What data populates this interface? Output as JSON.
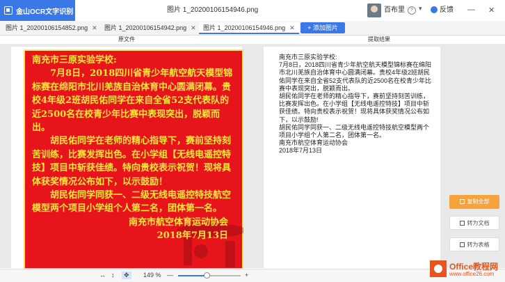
{
  "app": {
    "name": "金山OCR文字识别",
    "window_title": "图片 1_20200106154946.png"
  },
  "user": {
    "name": "百布里"
  },
  "header": {
    "feedback": "反馈",
    "minimize": "—",
    "close": "✕",
    "help": "?",
    "dropdown": "▾"
  },
  "tabs": [
    {
      "label": "图片 1_20200106154852.png",
      "active": false
    },
    {
      "label": "图片 1_20200106154942.png",
      "active": false
    },
    {
      "label": "图片 1_20200106154946.png",
      "active": true
    }
  ],
  "add_image": "+ 添加图片",
  "sections": {
    "left": "原文件",
    "right": "提取结果"
  },
  "poster": {
    "lines": [
      "南充市三原实验学校:",
      "7月8日，2018四川省青少年航空航天模型锦标赛在绵阳市北川羌族自治体育中心圆满闭幕。贵校4年级2班胡民佑同学在来自全省52支代表队的近2500名在校青少年比赛中表现突出，脱颖而出。",
      "胡民佑同学在老师的精心指导下，赛前坚持刻苦训练，比赛发挥出色。在小学组【无线电遥控特技】项目中斩获佳绩。特向贵校表示祝贺！现将具体获奖情况公布如下，以示鼓励！",
      "胡民佑同学同获一、二级无线电遥控特技航空模型两个项目小学组个人第二名，团体第一名。",
      "南充市航空体育运动协会",
      "2018年7月13日"
    ]
  },
  "result": {
    "lines": [
      "南充市三原实验学校:",
      "7月8日，2018四川省青少年航空航天模型锦标赛在绵阳市北川羌族自治体育中心圆满闭幕。贵校4年级2班胡民佑同学在来自全省52支代表队的近2500名在校青少年比赛中表现突出，脱颖而出。",
      "胡民佑同学在老师的精心指导下，赛前坚持刻苦训练，比赛发挥出色。在小学组【无线电遥控特技】项目中斩获佳绩。特向贵校表示祝贺！现将具体获奖情况公布如下，以示鼓励!",
      "胡民佑同学同获一、二级无线电遥控特技航空模型两个项目小学组个人第二名，团体第一名。",
      "南充市航空体育运动协会",
      "2018年7月13日"
    ]
  },
  "actions": {
    "copy_all": "复制全部",
    "to_word": "转为文档",
    "to_table": "转为表格"
  },
  "zoom": {
    "value": "149 %",
    "minus": "—",
    "plus": "+",
    "fit_width": "↔",
    "fit_height": "↕",
    "select_icon": "✥",
    "level": 0.45
  },
  "watermark": {
    "title": "Office教程网",
    "url": "www.office26.com"
  },
  "colors": {
    "accent": "#3b78e7",
    "poster_bg": "#e8141c",
    "poster_text": "#ffe83a",
    "copy_button": "#f7a23b",
    "watermark": "#e8541e"
  }
}
